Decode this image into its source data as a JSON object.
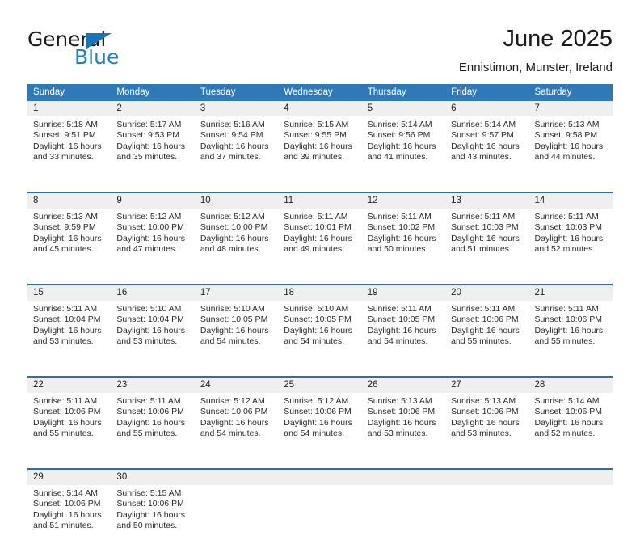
{
  "brand": {
    "line1": "General",
    "line2": "Blue",
    "triangle_color": "#1c72b8",
    "blue_text_color": "#2580c3"
  },
  "header": {
    "title": "June 2025",
    "subtitle": "Ennistimon, Munster, Ireland"
  },
  "theme": {
    "header_blue": "#3079b8",
    "separator_blue": "#2f6fa8",
    "daynum_band": "#efefef"
  },
  "weekday_headers": [
    "Sunday",
    "Monday",
    "Tuesday",
    "Wednesday",
    "Thursday",
    "Friday",
    "Saturday"
  ],
  "weeks": [
    {
      "days": [
        {
          "num": "1",
          "sunrise": "Sunrise: 5:18 AM",
          "sunset": "Sunset: 9:51 PM",
          "daylight1": "Daylight: 16 hours",
          "daylight2": "and 33 minutes."
        },
        {
          "num": "2",
          "sunrise": "Sunrise: 5:17 AM",
          "sunset": "Sunset: 9:53 PM",
          "daylight1": "Daylight: 16 hours",
          "daylight2": "and 35 minutes."
        },
        {
          "num": "3",
          "sunrise": "Sunrise: 5:16 AM",
          "sunset": "Sunset: 9:54 PM",
          "daylight1": "Daylight: 16 hours",
          "daylight2": "and 37 minutes."
        },
        {
          "num": "4",
          "sunrise": "Sunrise: 5:15 AM",
          "sunset": "Sunset: 9:55 PM",
          "daylight1": "Daylight: 16 hours",
          "daylight2": "and 39 minutes."
        },
        {
          "num": "5",
          "sunrise": "Sunrise: 5:14 AM",
          "sunset": "Sunset: 9:56 PM",
          "daylight1": "Daylight: 16 hours",
          "daylight2": "and 41 minutes."
        },
        {
          "num": "6",
          "sunrise": "Sunrise: 5:14 AM",
          "sunset": "Sunset: 9:57 PM",
          "daylight1": "Daylight: 16 hours",
          "daylight2": "and 43 minutes."
        },
        {
          "num": "7",
          "sunrise": "Sunrise: 5:13 AM",
          "sunset": "Sunset: 9:58 PM",
          "daylight1": "Daylight: 16 hours",
          "daylight2": "and 44 minutes."
        }
      ]
    },
    {
      "days": [
        {
          "num": "8",
          "sunrise": "Sunrise: 5:13 AM",
          "sunset": "Sunset: 9:59 PM",
          "daylight1": "Daylight: 16 hours",
          "daylight2": "and 45 minutes."
        },
        {
          "num": "9",
          "sunrise": "Sunrise: 5:12 AM",
          "sunset": "Sunset: 10:00 PM",
          "daylight1": "Daylight: 16 hours",
          "daylight2": "and 47 minutes."
        },
        {
          "num": "10",
          "sunrise": "Sunrise: 5:12 AM",
          "sunset": "Sunset: 10:00 PM",
          "daylight1": "Daylight: 16 hours",
          "daylight2": "and 48 minutes."
        },
        {
          "num": "11",
          "sunrise": "Sunrise: 5:11 AM",
          "sunset": "Sunset: 10:01 PM",
          "daylight1": "Daylight: 16 hours",
          "daylight2": "and 49 minutes."
        },
        {
          "num": "12",
          "sunrise": "Sunrise: 5:11 AM",
          "sunset": "Sunset: 10:02 PM",
          "daylight1": "Daylight: 16 hours",
          "daylight2": "and 50 minutes."
        },
        {
          "num": "13",
          "sunrise": "Sunrise: 5:11 AM",
          "sunset": "Sunset: 10:03 PM",
          "daylight1": "Daylight: 16 hours",
          "daylight2": "and 51 minutes."
        },
        {
          "num": "14",
          "sunrise": "Sunrise: 5:11 AM",
          "sunset": "Sunset: 10:03 PM",
          "daylight1": "Daylight: 16 hours",
          "daylight2": "and 52 minutes."
        }
      ]
    },
    {
      "days": [
        {
          "num": "15",
          "sunrise": "Sunrise: 5:11 AM",
          "sunset": "Sunset: 10:04 PM",
          "daylight1": "Daylight: 16 hours",
          "daylight2": "and 53 minutes."
        },
        {
          "num": "16",
          "sunrise": "Sunrise: 5:10 AM",
          "sunset": "Sunset: 10:04 PM",
          "daylight1": "Daylight: 16 hours",
          "daylight2": "and 53 minutes."
        },
        {
          "num": "17",
          "sunrise": "Sunrise: 5:10 AM",
          "sunset": "Sunset: 10:05 PM",
          "daylight1": "Daylight: 16 hours",
          "daylight2": "and 54 minutes."
        },
        {
          "num": "18",
          "sunrise": "Sunrise: 5:10 AM",
          "sunset": "Sunset: 10:05 PM",
          "daylight1": "Daylight: 16 hours",
          "daylight2": "and 54 minutes."
        },
        {
          "num": "19",
          "sunrise": "Sunrise: 5:11 AM",
          "sunset": "Sunset: 10:05 PM",
          "daylight1": "Daylight: 16 hours",
          "daylight2": "and 54 minutes."
        },
        {
          "num": "20",
          "sunrise": "Sunrise: 5:11 AM",
          "sunset": "Sunset: 10:06 PM",
          "daylight1": "Daylight: 16 hours",
          "daylight2": "and 55 minutes."
        },
        {
          "num": "21",
          "sunrise": "Sunrise: 5:11 AM",
          "sunset": "Sunset: 10:06 PM",
          "daylight1": "Daylight: 16 hours",
          "daylight2": "and 55 minutes."
        }
      ]
    },
    {
      "days": [
        {
          "num": "22",
          "sunrise": "Sunrise: 5:11 AM",
          "sunset": "Sunset: 10:06 PM",
          "daylight1": "Daylight: 16 hours",
          "daylight2": "and 55 minutes."
        },
        {
          "num": "23",
          "sunrise": "Sunrise: 5:11 AM",
          "sunset": "Sunset: 10:06 PM",
          "daylight1": "Daylight: 16 hours",
          "daylight2": "and 55 minutes."
        },
        {
          "num": "24",
          "sunrise": "Sunrise: 5:12 AM",
          "sunset": "Sunset: 10:06 PM",
          "daylight1": "Daylight: 16 hours",
          "daylight2": "and 54 minutes."
        },
        {
          "num": "25",
          "sunrise": "Sunrise: 5:12 AM",
          "sunset": "Sunset: 10:06 PM",
          "daylight1": "Daylight: 16 hours",
          "daylight2": "and 54 minutes."
        },
        {
          "num": "26",
          "sunrise": "Sunrise: 5:13 AM",
          "sunset": "Sunset: 10:06 PM",
          "daylight1": "Daylight: 16 hours",
          "daylight2": "and 53 minutes."
        },
        {
          "num": "27",
          "sunrise": "Sunrise: 5:13 AM",
          "sunset": "Sunset: 10:06 PM",
          "daylight1": "Daylight: 16 hours",
          "daylight2": "and 53 minutes."
        },
        {
          "num": "28",
          "sunrise": "Sunrise: 5:14 AM",
          "sunset": "Sunset: 10:06 PM",
          "daylight1": "Daylight: 16 hours",
          "daylight2": "and 52 minutes."
        }
      ]
    },
    {
      "days": [
        {
          "num": "29",
          "sunrise": "Sunrise: 5:14 AM",
          "sunset": "Sunset: 10:06 PM",
          "daylight1": "Daylight: 16 hours",
          "daylight2": "and 51 minutes."
        },
        {
          "num": "30",
          "sunrise": "Sunrise: 5:15 AM",
          "sunset": "Sunset: 10:06 PM",
          "daylight1": "Daylight: 16 hours",
          "daylight2": "and 50 minutes."
        },
        {
          "num": "",
          "sunrise": "",
          "sunset": "",
          "daylight1": "",
          "daylight2": ""
        },
        {
          "num": "",
          "sunrise": "",
          "sunset": "",
          "daylight1": "",
          "daylight2": ""
        },
        {
          "num": "",
          "sunrise": "",
          "sunset": "",
          "daylight1": "",
          "daylight2": ""
        },
        {
          "num": "",
          "sunrise": "",
          "sunset": "",
          "daylight1": "",
          "daylight2": ""
        },
        {
          "num": "",
          "sunrise": "",
          "sunset": "",
          "daylight1": "",
          "daylight2": ""
        }
      ]
    }
  ]
}
